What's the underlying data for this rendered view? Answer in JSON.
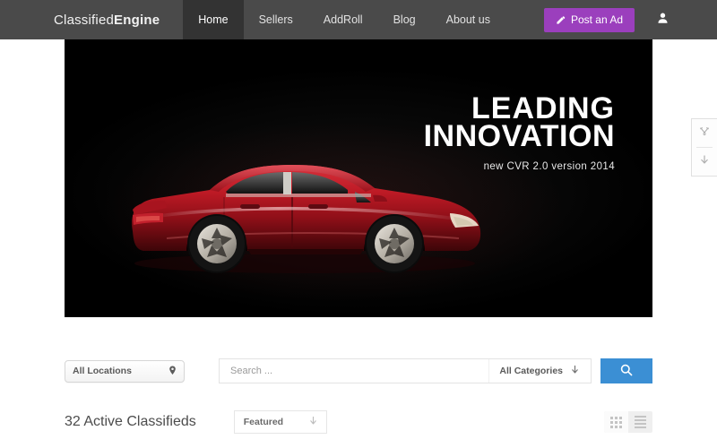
{
  "header": {
    "logo": {
      "first": "Classified",
      "second": "Engine"
    },
    "nav": [
      {
        "label": "Home",
        "active": true
      },
      {
        "label": "Sellers",
        "active": false
      },
      {
        "label": "AddRoll",
        "active": false
      },
      {
        "label": "Blog",
        "active": false
      },
      {
        "label": "About us",
        "active": false
      }
    ],
    "post_ad_label": "Post an Ad",
    "post_ad_color": "#9b3fbd",
    "post_ad_icon": "edit-pencil-icon",
    "account_icon": "user-icon",
    "background_color": "#4a4a4a",
    "active_tab_color": "#333333"
  },
  "hero": {
    "title_line1": "LEADING",
    "title_line2": "INNOVATION",
    "subtitle": "new CVR 2.0 version 2014",
    "background_color": "#000000",
    "image_subject": "red sedan car side profile",
    "car_color": "#b31520"
  },
  "side_panel": {
    "buttons": [
      {
        "icon": "tools-icon"
      },
      {
        "icon": "download-arrow-icon"
      }
    ]
  },
  "search": {
    "location_label": "All Locations",
    "location_icon": "map-pin-icon",
    "placeholder": "Search ...",
    "input_value": "",
    "category_label": "All Categories",
    "category_icon": "arrow-down-icon",
    "button_icon": "search-icon",
    "button_color": "#3b8fd4"
  },
  "results": {
    "count_label": "32 Active Classifieds",
    "sort_label": "Featured",
    "sort_icon": "arrow-down-icon",
    "view_modes": [
      {
        "name": "grid",
        "icon": "grid-view-icon",
        "active": true
      },
      {
        "name": "list",
        "icon": "list-view-icon",
        "active": false
      }
    ]
  }
}
